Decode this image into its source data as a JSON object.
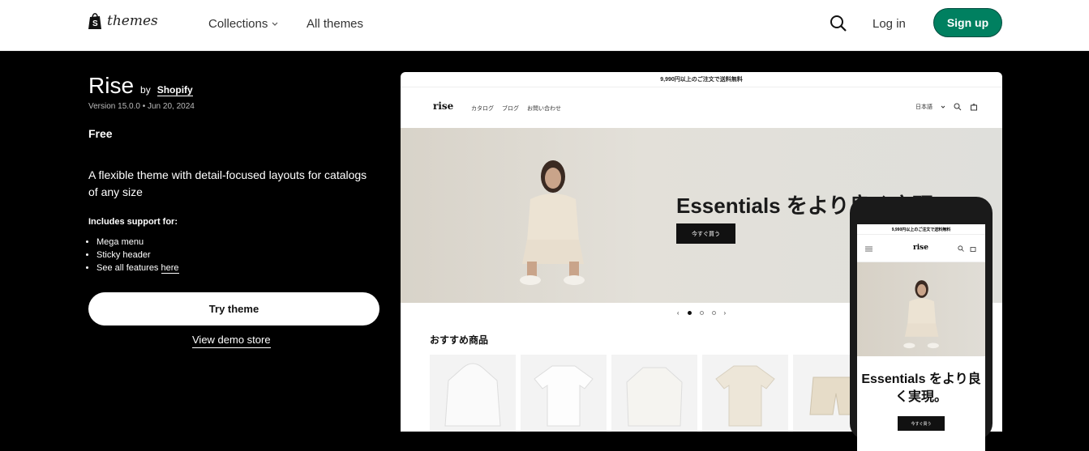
{
  "topnav": {
    "logo_text": "themes",
    "collections_label": "Collections",
    "all_themes_label": "All themes",
    "login_label": "Log in",
    "signup_label": "Sign up"
  },
  "theme": {
    "name": "Rise",
    "by_label": "by",
    "author": "Shopify",
    "version": "Version 15.0.0 • Jun 20, 2024",
    "price": "Free",
    "description": "A flexible theme with detail-focused layouts for catalogs of any size",
    "support_heading": "Includes support for:",
    "features": [
      "Mega menu",
      "Sticky header",
      "See all features "
    ],
    "features_link": "here",
    "try_label": "Try theme",
    "demo_label": "View demo store"
  },
  "preview": {
    "announcement": "9,990円以上のご注文で送料無料",
    "store_logo": "rise",
    "menu": [
      "カタログ",
      "ブログ",
      "お問い合わせ"
    ],
    "language": "日本語",
    "hero_title": "Essentials をより良く実現",
    "hero_button": "今すぐ買う",
    "prev": "‹",
    "next": "›",
    "products_heading": "おすすめ商品",
    "mobile_hero_title": "Essentials をより良く実現。",
    "mobile_button": "今すぐ買う"
  },
  "colors": {
    "signup_bg": "#008060",
    "page_bg": "#000000"
  }
}
